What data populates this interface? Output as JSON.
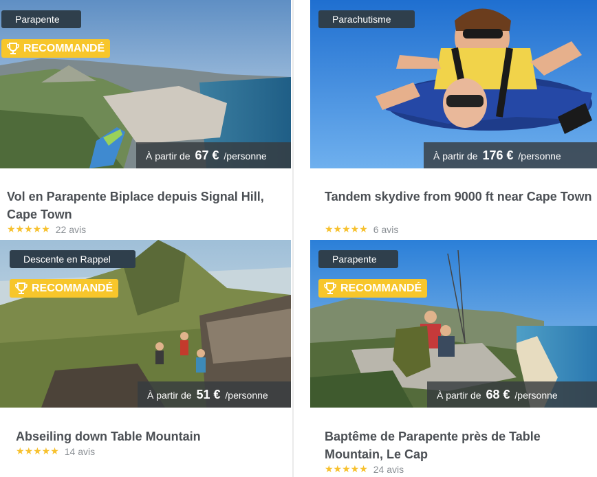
{
  "cards": [
    {
      "category": "Parapente",
      "recommended_label": "RECOMMANDÉ",
      "price_prefix": "À partir de",
      "price": "67 €",
      "price_suffix": "/personne",
      "title": "Vol en Parapente Biplace depuis Signal Hill, Cape Town",
      "stars": "★★★★★",
      "reviews": "22 avis"
    },
    {
      "category": "Parachutisme",
      "price_prefix": "À partir de",
      "price": "176 €",
      "price_suffix": "/personne",
      "title": "Tandem skydive from 9000 ft near Cape Town",
      "stars": "★★★★★",
      "reviews": "6 avis"
    },
    {
      "category": "Descente en Rappel",
      "recommended_label": "RECOMMANDÉ",
      "price_prefix": "À partir de",
      "price": "51 €",
      "price_suffix": "/personne",
      "title": "Abseiling down Table Mountain",
      "stars": "★★★★★",
      "reviews": "14 avis"
    },
    {
      "category": "Parapente",
      "recommended_label": "RECOMMANDÉ",
      "price_prefix": "À partir de",
      "price": "68 €",
      "price_suffix": "/personne",
      "title": "Baptême de Parapente près de Table Mountain, Le Cap",
      "stars": "★★★★★",
      "reviews": "24 avis"
    }
  ],
  "colors": {
    "badge_dark": "#2f3f4c",
    "badge_recommended": "#f7c62b",
    "star": "#f7c12e",
    "title": "#4b4f54"
  }
}
